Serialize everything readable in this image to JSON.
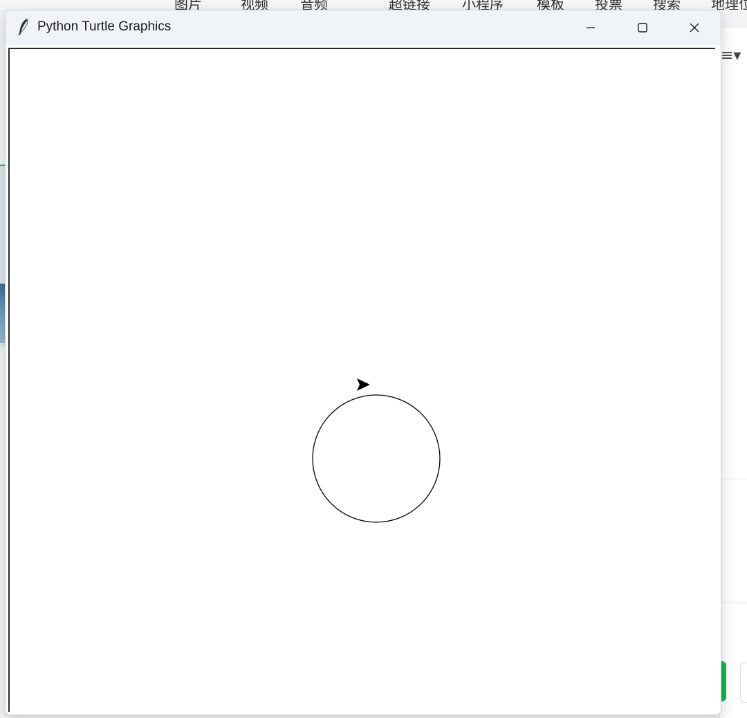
{
  "background_app": {
    "menu_items": [
      "图片",
      "视频",
      "音频",
      "超链接",
      "小程序",
      "模板",
      "投票",
      "搜索",
      "地理位置"
    ]
  },
  "window": {
    "title": "Python Turtle Graphics",
    "controls": {
      "minimize_glyph": "—",
      "maximize_glyph": "☐",
      "close_glyph": "✕"
    }
  },
  "turtle_canvas": {
    "background_color": "#ffffff",
    "shape": "circle",
    "pen_color": "#000000",
    "turtle_shape": "arrow",
    "turtle_heading": "east"
  }
}
